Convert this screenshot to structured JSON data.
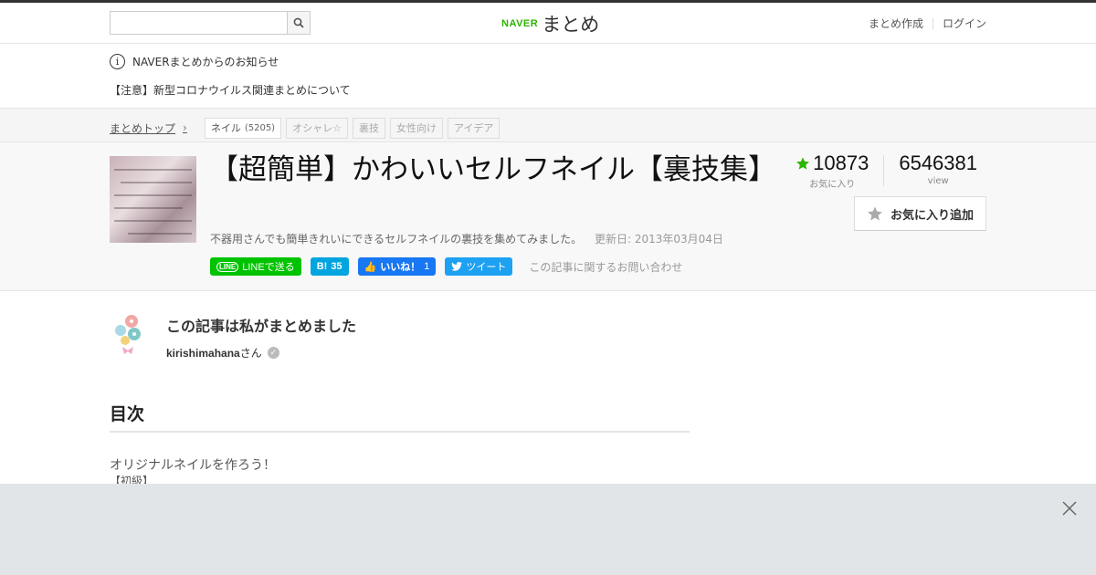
{
  "header": {
    "search_placeholder": "",
    "logo_brand": "NAVER",
    "logo_text": "まとめ",
    "links": [
      "まとめ作成",
      "ログイン"
    ]
  },
  "notice": {
    "heading": "NAVERまとめからのお知らせ",
    "item": "【注意】新型コロナウイルス関連まとめについて"
  },
  "breadcrumb": {
    "top": "まとめトップ",
    "tags": [
      {
        "label": "ネイル",
        "count": "(5205)"
      },
      {
        "label": "オシャレ☆"
      },
      {
        "label": "裏技"
      },
      {
        "label": "女性向け"
      },
      {
        "label": "アイデア"
      }
    ]
  },
  "article": {
    "title": "【超簡単】かわいいセルフネイル【裏技集】",
    "description": "不器用さんでも簡単きれいにできるセルフネイルの裏技を集めてみました。",
    "updated": "更新日: 2013年03月04日",
    "share": {
      "line": "LINEで送る",
      "hatena_count": "35",
      "fb_label": "いいね！",
      "fb_count": "1",
      "tweet": "ツイート",
      "inquiry": "この記事に関するお問い合わせ"
    },
    "favorites": "10873",
    "favorites_label": "お気に入り",
    "views": "6546381",
    "views_label": "view",
    "fav_button": "お気に入り追加"
  },
  "author": {
    "heading": "この記事は私がまとめました",
    "name": "kirishimahana",
    "suffix": "さん"
  },
  "toc": {
    "title": "目次",
    "items": [
      "オリジナルネイルを作ろう！",
      "【初級】"
    ]
  },
  "colors": {
    "accent_green": "#2db400",
    "line_green": "#00c300",
    "hatena_blue": "#00a4de",
    "fb_blue": "#1877f2",
    "twitter_blue": "#1da1f2"
  }
}
